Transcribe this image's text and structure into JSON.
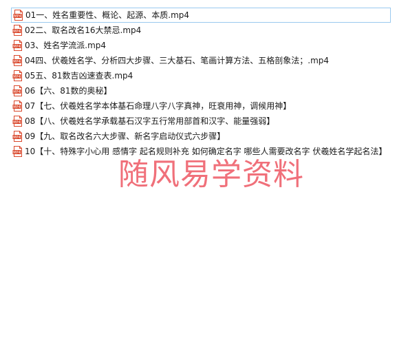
{
  "files": [
    {
      "name": "01一、姓名重要性、概论、起源、本质.mp4",
      "icon": "mp4-file-icon",
      "selected": true
    },
    {
      "name": "02二、取名改名16大禁忌.mp4",
      "icon": "mp4-file-icon",
      "selected": false
    },
    {
      "name": "03、姓名学流派.mp4",
      "icon": "mp4-file-icon",
      "selected": false
    },
    {
      "name": "04四、伏羲姓名学、分析四大步骤、三大基石、笔画计算方法、五格剖象法；.mp4",
      "icon": "mp4-file-icon",
      "selected": false
    },
    {
      "name": "05五、81数吉凶速查表.mp4",
      "icon": "mp4-file-icon",
      "selected": false
    },
    {
      "name": "06【六、81数的奥秘】",
      "icon": "mp4-file-icon",
      "selected": false
    },
    {
      "name": "07【七、伏羲姓名学本体基石命理八字八字真神，旺衰用神，调候用神】",
      "icon": "mp4-file-icon",
      "selected": false
    },
    {
      "name": "08【八、伏羲姓名学承载基石汉字五行常用部首和汉字、能量强弱】",
      "icon": "mp4-file-icon",
      "selected": false
    },
    {
      "name": "09【九、取名改名六大步骤、新名字启动仪式六步骤】",
      "icon": "mp4-file-icon",
      "selected": false
    },
    {
      "name": "10【十、特殊字小心用 感情字 起名规则补充 如何确定名字 哪些人需要改名字 伏羲姓名学起名法】",
      "icon": "mp4-file-icon",
      "selected": false
    }
  ],
  "icon_label": "MP4",
  "watermark": "随风易学资料",
  "colors": {
    "icon_red": "#d9472b",
    "selection_border": "#99c9ef",
    "watermark": "#f0707a"
  }
}
